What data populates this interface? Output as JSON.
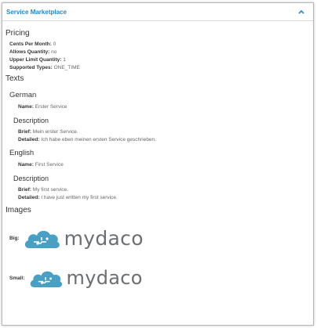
{
  "panel": {
    "title": "Service Marketplace",
    "collapse_icon": "chevron-up-icon",
    "accent": "#1e88d7"
  },
  "pricing": {
    "heading": "Pricing",
    "rows": [
      {
        "label": "Cents Per Month:",
        "value": "0"
      },
      {
        "label": "Allows Quantity:",
        "value": "no"
      },
      {
        "label": "Upper Limit Quantity:",
        "value": "1"
      },
      {
        "label": "Supported Types:",
        "value": "ONE_TIME"
      }
    ]
  },
  "texts": {
    "heading": "Texts",
    "german": {
      "heading": "German",
      "name_label": "Name:",
      "name_value": "Erster Service",
      "description_heading": "Description",
      "brief_label": "Brief:",
      "brief_value": "Mein erster Service.",
      "detailed_label": "Detailed:",
      "detailed_value": "Ich habe eben meinen ersten Service geschrieben."
    },
    "english": {
      "heading": "English",
      "name_label": "Name:",
      "name_value": "First Service",
      "description_heading": "Description",
      "brief_label": "Brief:",
      "brief_value": "My first service.",
      "detailed_label": "Detailed:",
      "detailed_value": "I have just written my first service."
    }
  },
  "images": {
    "heading": "Images",
    "big": {
      "label": "Big:",
      "logo_text": "mydaco",
      "logo_color": "#4a9fc4"
    },
    "small": {
      "label": "Small:",
      "logo_text": "mydaco",
      "logo_color": "#4a9fc4"
    }
  }
}
